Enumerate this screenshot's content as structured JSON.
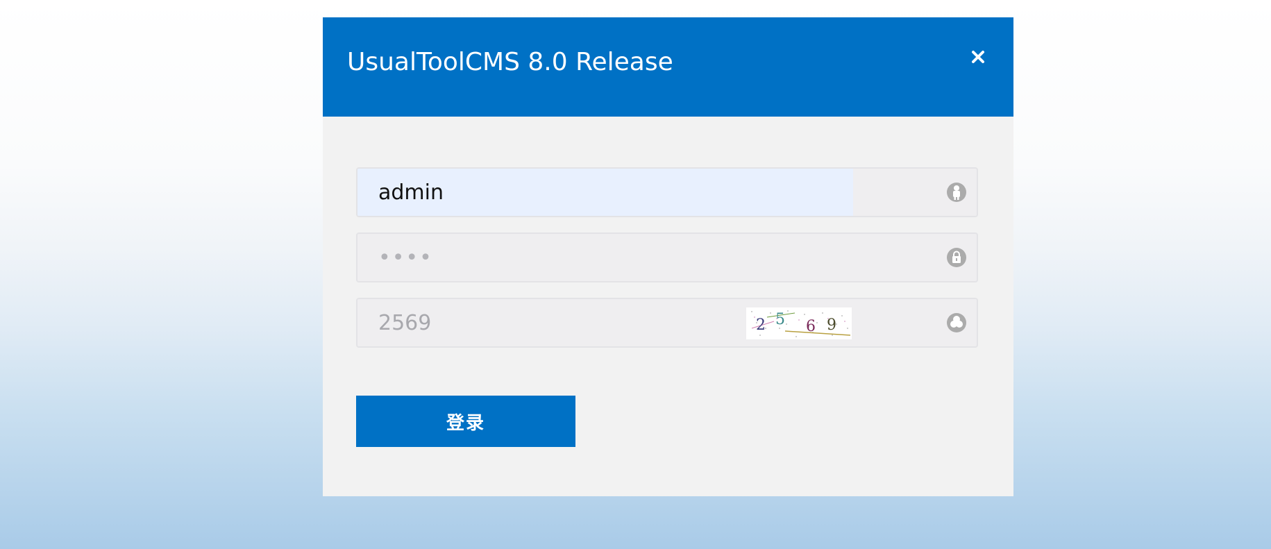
{
  "colors": {
    "accent": "#0071c5",
    "dialog_bg": "#f2f2f2",
    "field_bg": "#efeef0",
    "autofill_bg": "#e8f0fe",
    "icon_gray": "#aaaaaa"
  },
  "dialog": {
    "title": "UsualToolCMS 8.0 Release",
    "close_icon": "close-icon"
  },
  "form": {
    "username": {
      "value": "admin",
      "icon": "user-icon"
    },
    "password": {
      "placeholder": "••••",
      "icon": "lock-icon"
    },
    "captcha": {
      "placeholder": "2569",
      "image_text": "2569",
      "icon": "captcha-icon"
    },
    "submit_label": "登录"
  }
}
